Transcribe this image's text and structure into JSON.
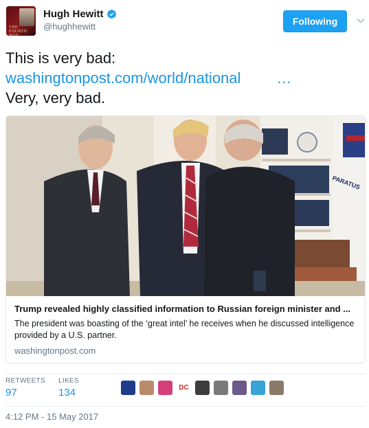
{
  "author": {
    "display_name": "Hugh Hewitt",
    "handle": "@hughhewitt",
    "avatar_text": "THE FOURTH WAY",
    "verified": true
  },
  "follow_button": {
    "label": "Following"
  },
  "tweet": {
    "line1": "This is very bad:",
    "link": "washingtonpost.com/world/national",
    "ellipsis": "…",
    "line3": "Very, very bad."
  },
  "card": {
    "title": "Trump revealed highly classified information to Russian foreign minister and ...",
    "description": "The president was boasting of the ‘great intel’ he receives when he discussed intelligence provided by a U.S. partner.",
    "domain": "washingtonpost.com",
    "photo_text": "PARATUS"
  },
  "stats": {
    "retweets_label": "RETWEETS",
    "retweets_value": "97",
    "likes_label": "LIKES",
    "likes_value": "134"
  },
  "likers": [
    {
      "name": "liker-rangers-logo",
      "color": "#1f3c8c"
    },
    {
      "name": "liker-2",
      "color": "#b98a6a"
    },
    {
      "name": "liker-3",
      "color": "#d6407a"
    },
    {
      "name": "liker-dc-logo",
      "color": "#d31f26",
      "text": "DC"
    },
    {
      "name": "liker-5",
      "color": "#3d3d3d"
    },
    {
      "name": "liker-6",
      "color": "#7a7a7a"
    },
    {
      "name": "liker-7",
      "color": "#6c5a8a"
    },
    {
      "name": "liker-8",
      "color": "#3aa3d6"
    },
    {
      "name": "liker-9",
      "color": "#8a7a6a"
    }
  ],
  "timestamp": "4:12 PM - 15 May 2017",
  "colors": {
    "accent": "#1da1f2",
    "link": "#1b95e0",
    "secondary_text": "#657786",
    "border": "#e1e8ed"
  }
}
